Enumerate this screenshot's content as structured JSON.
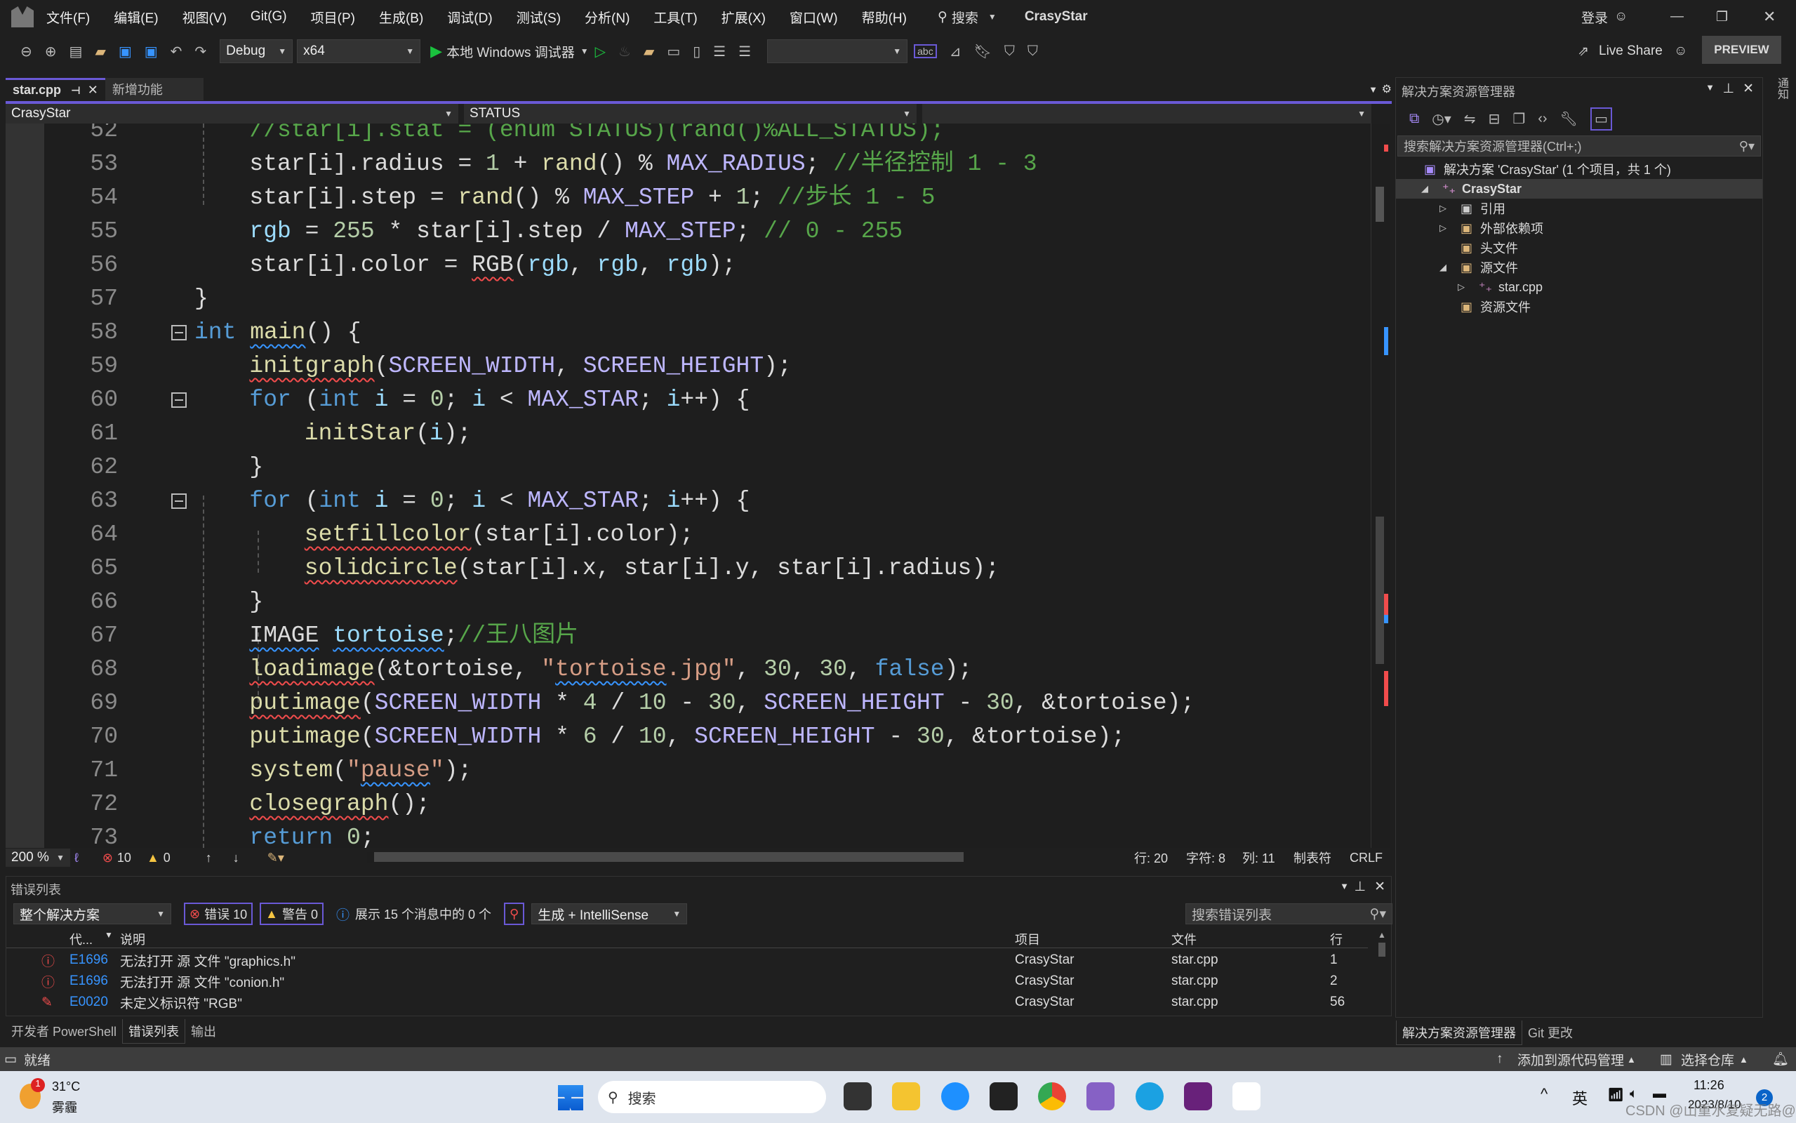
{
  "title_bar": {
    "menus": [
      "文件(F)",
      "编辑(E)",
      "视图(V)",
      "Git(G)",
      "项目(P)",
      "生成(B)",
      "调试(D)",
      "测试(S)",
      "分析(N)",
      "工具(T)",
      "扩展(X)",
      "窗口(W)",
      "帮助(H)"
    ],
    "search": "搜索",
    "solution_name": "CrasyStar",
    "login": "登录"
  },
  "toolbar": {
    "config": "Debug",
    "platform": "x64",
    "run_label": "本地 Windows 调试器",
    "live_share": "Live Share",
    "preview": "PREVIEW"
  },
  "tabs": [
    {
      "label": "star.cpp",
      "active": true
    },
    {
      "label": "新增功能",
      "active": false
    }
  ],
  "navbar": {
    "project": "CrasyStar",
    "scope": "STATUS"
  },
  "code_lines": [
    {
      "n": "52",
      "i": 4,
      "t": [
        [
          "//star[i].stat = (enum STATUS)(rand()%ALL_STATUS);",
          "cmt"
        ]
      ]
    },
    {
      "n": "53",
      "i": 4,
      "t": [
        [
          "star[i].radius = ",
          "plain"
        ],
        [
          "1",
          "num"
        ],
        [
          " + ",
          "plain"
        ],
        [
          "rand",
          "fn"
        ],
        [
          "() % ",
          "plain"
        ],
        [
          "MAX_RADIUS",
          "mac"
        ],
        [
          "; ",
          "plain"
        ],
        [
          "//半径控制 1 - 3",
          "cmt"
        ]
      ]
    },
    {
      "n": "54",
      "i": 4,
      "t": [
        [
          "star[i].step = ",
          "plain"
        ],
        [
          "rand",
          "fn"
        ],
        [
          "() % ",
          "plain"
        ],
        [
          "MAX_STEP",
          "mac"
        ],
        [
          " + ",
          "plain"
        ],
        [
          "1",
          "num"
        ],
        [
          "; ",
          "plain"
        ],
        [
          "//步长 1 - 5",
          "cmt"
        ]
      ]
    },
    {
      "n": "55",
      "i": 4,
      "t": [
        [
          "rgb",
          "var"
        ],
        [
          " = ",
          "plain"
        ],
        [
          "255",
          "num"
        ],
        [
          " * star[i].step / ",
          "plain"
        ],
        [
          "MAX_STEP",
          "mac"
        ],
        [
          "; ",
          "plain"
        ],
        [
          "// 0 - 255",
          "cmt"
        ]
      ]
    },
    {
      "n": "56",
      "i": 4,
      "t": [
        [
          "star[i].color = ",
          "plain"
        ],
        [
          "RGB",
          "plain err"
        ],
        [
          "(",
          "plain"
        ],
        [
          "rgb",
          "var"
        ],
        [
          ", ",
          "plain"
        ],
        [
          "rgb",
          "var"
        ],
        [
          ", ",
          "plain"
        ],
        [
          "rgb",
          "var"
        ],
        [
          ");",
          "plain"
        ]
      ]
    },
    {
      "n": "57",
      "i": 0,
      "t": [
        [
          "}",
          "plain"
        ]
      ]
    },
    {
      "n": "58",
      "i": 0,
      "t": [
        [
          "int",
          "kw"
        ],
        [
          " ",
          "plain"
        ],
        [
          "main",
          "fn info"
        ],
        [
          "() {",
          "plain"
        ]
      ]
    },
    {
      "n": "59",
      "i": 4,
      "t": [
        [
          "initgraph",
          "fn err"
        ],
        [
          "(",
          "plain"
        ],
        [
          "SCREEN_WIDTH",
          "mac"
        ],
        [
          ", ",
          "plain"
        ],
        [
          "SCREEN_HEIGHT",
          "mac"
        ],
        [
          ");",
          "plain"
        ]
      ]
    },
    {
      "n": "60",
      "i": 4,
      "t": [
        [
          "for",
          "kw"
        ],
        [
          " (",
          "plain"
        ],
        [
          "int",
          "kw"
        ],
        [
          " ",
          "plain"
        ],
        [
          "i",
          "var"
        ],
        [
          " = ",
          "plain"
        ],
        [
          "0",
          "num"
        ],
        [
          "; ",
          "plain"
        ],
        [
          "i",
          "var"
        ],
        [
          " < ",
          "plain"
        ],
        [
          "MAX_STAR",
          "mac"
        ],
        [
          "; ",
          "plain"
        ],
        [
          "i",
          "var"
        ],
        [
          "++) {",
          "plain"
        ]
      ]
    },
    {
      "n": "61",
      "i": 8,
      "t": [
        [
          "initStar",
          "fn"
        ],
        [
          "(",
          "plain"
        ],
        [
          "i",
          "var"
        ],
        [
          ");",
          "plain"
        ]
      ]
    },
    {
      "n": "62",
      "i": 4,
      "t": [
        [
          "}",
          "plain"
        ]
      ]
    },
    {
      "n": "63",
      "i": 4,
      "t": [
        [
          "for",
          "kw"
        ],
        [
          " (",
          "plain"
        ],
        [
          "int",
          "kw"
        ],
        [
          " ",
          "plain"
        ],
        [
          "i",
          "var"
        ],
        [
          " = ",
          "plain"
        ],
        [
          "0",
          "num"
        ],
        [
          "; ",
          "plain"
        ],
        [
          "i",
          "var"
        ],
        [
          " < ",
          "plain"
        ],
        [
          "MAX_STAR",
          "mac"
        ],
        [
          "; ",
          "plain"
        ],
        [
          "i",
          "var"
        ],
        [
          "++) {",
          "plain"
        ]
      ]
    },
    {
      "n": "64",
      "i": 8,
      "t": [
        [
          "setfillcolor",
          "fn err"
        ],
        [
          "(star[i].color);",
          "plain"
        ]
      ]
    },
    {
      "n": "65",
      "i": 8,
      "t": [
        [
          "solidcircle",
          "fn err"
        ],
        [
          "(star[i].x, star[i].y, star[i].radius);",
          "plain"
        ]
      ]
    },
    {
      "n": "66",
      "i": 4,
      "t": [
        [
          "}",
          "plain"
        ]
      ]
    },
    {
      "n": "67",
      "i": 4,
      "t": [
        [
          "IMAGE",
          "plain info"
        ],
        [
          " ",
          "plain"
        ],
        [
          "tortoise",
          "var info"
        ],
        [
          ";",
          "plain"
        ],
        [
          "//王八图片",
          "cmt"
        ]
      ]
    },
    {
      "n": "68",
      "i": 4,
      "t": [
        [
          "loadimage",
          "fn err"
        ],
        [
          "(&tortoise, ",
          "plain"
        ],
        [
          "\"",
          "str"
        ],
        [
          "tortoise",
          "str info"
        ],
        [
          ".jpg\"",
          "str"
        ],
        [
          ", ",
          "plain"
        ],
        [
          "30",
          "num"
        ],
        [
          ", ",
          "plain"
        ],
        [
          "30",
          "num"
        ],
        [
          ", ",
          "plain"
        ],
        [
          "false",
          "kw"
        ],
        [
          ");",
          "plain"
        ]
      ]
    },
    {
      "n": "69",
      "i": 4,
      "t": [
        [
          "putimage",
          "fn err"
        ],
        [
          "(",
          "plain"
        ],
        [
          "SCREEN_WIDTH",
          "mac"
        ],
        [
          " * ",
          "plain"
        ],
        [
          "4",
          "num"
        ],
        [
          " / ",
          "plain"
        ],
        [
          "10",
          "num"
        ],
        [
          " - ",
          "plain"
        ],
        [
          "30",
          "num"
        ],
        [
          ", ",
          "plain"
        ],
        [
          "SCREEN_HEIGHT",
          "mac"
        ],
        [
          " - ",
          "plain"
        ],
        [
          "30",
          "num"
        ],
        [
          ", &tortoise);",
          "plain"
        ]
      ]
    },
    {
      "n": "70",
      "i": 4,
      "t": [
        [
          "putimage",
          "fn"
        ],
        [
          "(",
          "plain"
        ],
        [
          "SCREEN_WIDTH",
          "mac"
        ],
        [
          " * ",
          "plain"
        ],
        [
          "6",
          "num"
        ],
        [
          " / ",
          "plain"
        ],
        [
          "10",
          "num"
        ],
        [
          ", ",
          "plain"
        ],
        [
          "SCREEN_HEIGHT",
          "mac"
        ],
        [
          " - ",
          "plain"
        ],
        [
          "30",
          "num"
        ],
        [
          ", &tortoise);",
          "plain"
        ]
      ]
    },
    {
      "n": "71",
      "i": 4,
      "t": [
        [
          "system",
          "fn"
        ],
        [
          "(",
          "plain"
        ],
        [
          "\"",
          "str"
        ],
        [
          "pause",
          "str info"
        ],
        [
          "\"",
          "str"
        ],
        [
          ");",
          "plain"
        ]
      ]
    },
    {
      "n": "72",
      "i": 4,
      "t": [
        [
          "closegraph",
          "fn err"
        ],
        [
          "();",
          "plain"
        ]
      ]
    },
    {
      "n": "73",
      "i": 4,
      "t": [
        [
          "return",
          "kw"
        ],
        [
          " ",
          "plain"
        ],
        [
          "0",
          "num"
        ],
        [
          ";",
          "plain"
        ]
      ]
    }
  ],
  "editor_status": {
    "zoom": "200 %",
    "errors": "10",
    "warnings": "0",
    "line": "行: 20",
    "char": "字符: 8",
    "col": "列: 11",
    "tabs": "制表符",
    "eol": "CRLF"
  },
  "error_list": {
    "title": "错误列表",
    "scope": "整个解决方案",
    "errors_btn": "错误 10",
    "warnings_btn": "警告 0",
    "messages": "展示 15 个消息中的 0 个",
    "source": "生成 + IntelliSense",
    "search_placeholder": "搜索错误列表",
    "columns": [
      "代...",
      "说明",
      "项目",
      "文件",
      "行"
    ],
    "rows": [
      {
        "icon": "error-icon",
        "code": "E1696",
        "desc": "无法打开 源 文件 \"graphics.h\"",
        "project": "CrasyStar",
        "file": "star.cpp",
        "line": "1"
      },
      {
        "icon": "error-icon",
        "code": "E1696",
        "desc": "无法打开 源 文件 \"conion.h\"",
        "project": "CrasyStar",
        "file": "star.cpp",
        "line": "2"
      },
      {
        "icon": "spelling-icon",
        "code": "E0020",
        "desc": "未定义标识符 \"RGB\"",
        "project": "CrasyStar",
        "file": "star.cpp",
        "line": "56"
      }
    ]
  },
  "bottom_tabs": [
    "开发者 PowerShell",
    "错误列表",
    "输出"
  ],
  "solution_explorer": {
    "title": "解决方案资源管理器",
    "search_placeholder": "搜索解决方案资源管理器(Ctrl+;)",
    "tree": [
      {
        "label": "解决方案 'CrasyStar' (1 个项目，共 1 个)",
        "depth": 0,
        "expander": "",
        "icon": "solution-icon"
      },
      {
        "label": "CrasyStar",
        "depth": 1,
        "expander": "◢",
        "icon": "cpp-project-icon",
        "selected": true
      },
      {
        "label": "引用",
        "depth": 2,
        "expander": "▷",
        "icon": "references-icon"
      },
      {
        "label": "外部依赖项",
        "depth": 2,
        "expander": "▷",
        "icon": "external-deps-icon"
      },
      {
        "label": "头文件",
        "depth": 2,
        "expander": "",
        "icon": "filter-folder-icon"
      },
      {
        "label": "源文件",
        "depth": 2,
        "expander": "◢",
        "icon": "filter-folder-icon"
      },
      {
        "label": "star.cpp",
        "depth": 3,
        "expander": "▷",
        "icon": "cpp-file-icon"
      },
      {
        "label": "资源文件",
        "depth": 2,
        "expander": "",
        "icon": "filter-folder-icon"
      }
    ],
    "tabs": [
      "解决方案资源管理器",
      "Git 更改"
    ],
    "notify_label": "通知"
  },
  "status_bar": {
    "ready": "就绪",
    "add_source": "添加到源代码管理",
    "select_repo": "选择仓库"
  },
  "taskbar": {
    "weather_temp": "31°C",
    "weather_desc": "雾霾",
    "weather_badge": "1",
    "search": "搜索",
    "ime": "英",
    "time": "11:26",
    "date": "2023/8/10",
    "notif_count": "2",
    "watermark": "CSDN @山重水复疑无路@"
  },
  "colors": {
    "accent": "#6a59d6",
    "error": "#f14c4c",
    "info": "#3794ff",
    "run": "#1ac23e"
  }
}
